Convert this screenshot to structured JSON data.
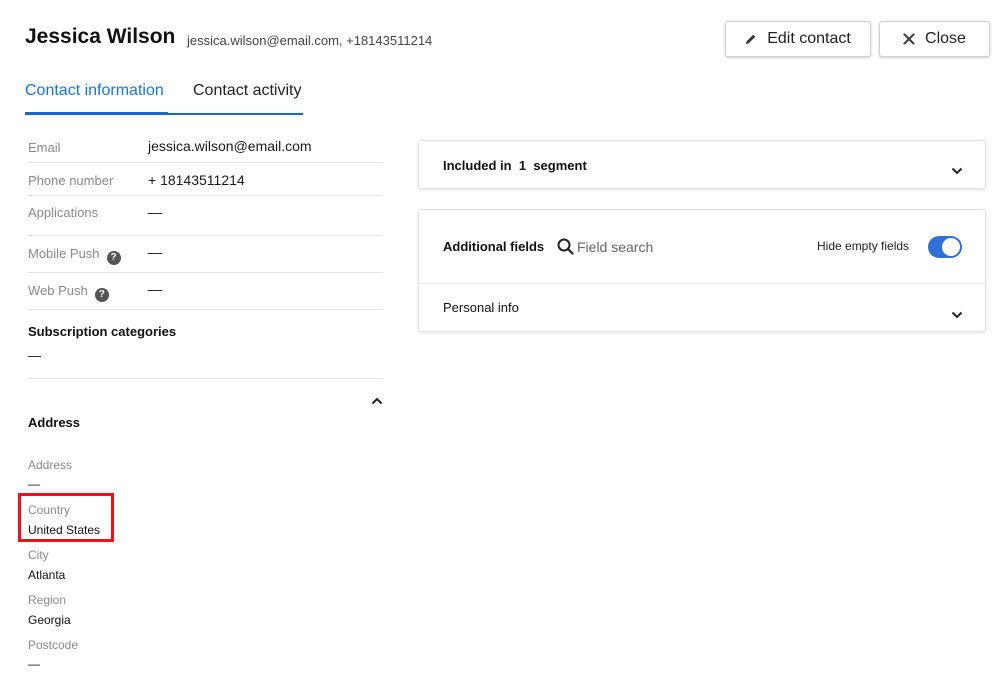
{
  "header": {
    "name": "Jessica Wilson",
    "subtitle": "jessica.wilson@email.com, +18143511214",
    "edit_label": "Edit contact",
    "close_label": "Close"
  },
  "tabs": [
    {
      "label": "Contact information",
      "active": true
    },
    {
      "label": "Contact activity",
      "active": false
    }
  ],
  "contact": {
    "email_label": "Email",
    "email_value": "jessica.wilson@email.com",
    "phone_label": "Phone number",
    "phone_value": "+ 18143511214",
    "applications_label": "Applications",
    "applications_value": "—",
    "mobile_push_label": "Mobile Push",
    "mobile_push_value": "—",
    "web_push_label": "Web Push",
    "web_push_value": "—"
  },
  "subscription": {
    "title": "Subscription categories",
    "value": "—"
  },
  "address": {
    "title": "Address",
    "fields": [
      {
        "label": "Address",
        "value": "—"
      },
      {
        "label": "Country",
        "value": "United States"
      },
      {
        "label": "City",
        "value": "Atlanta"
      },
      {
        "label": "Region",
        "value": "Georgia"
      },
      {
        "label": "Postcode",
        "value": "—"
      }
    ]
  },
  "segments": {
    "prefix": "Included in",
    "count": "1",
    "suffix": "segment"
  },
  "additional": {
    "title": "Additional fields",
    "search_placeholder": "Field search",
    "hide_empty_label": "Hide empty fields",
    "hide_empty_on": true,
    "personal_info_label": "Personal info"
  },
  "colors": {
    "accent": "#1967d2",
    "highlight": "#e8141a"
  },
  "icons": {
    "edit": "pencil-icon",
    "close": "close-x-icon",
    "help": "question-circle-icon",
    "search": "magnifier-icon",
    "chevron_down": "chevron-down-icon",
    "chevron_up": "chevron-up-icon"
  }
}
